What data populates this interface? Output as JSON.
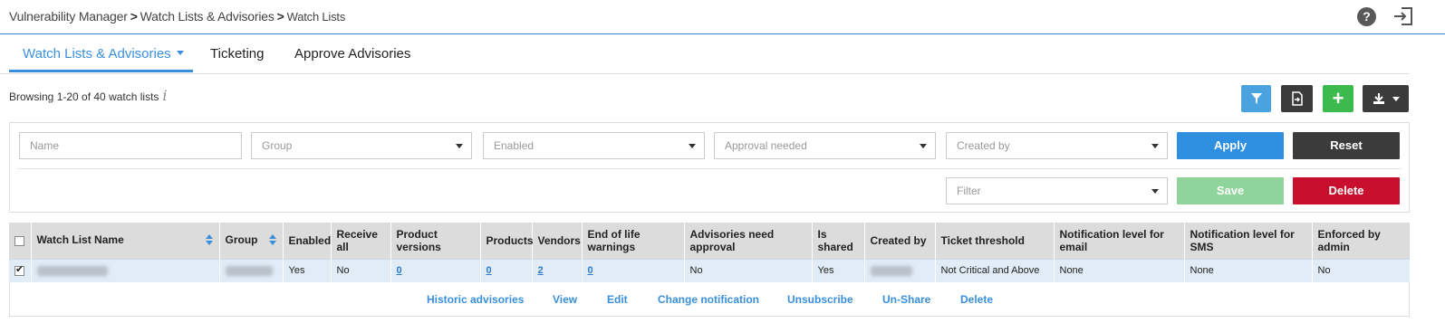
{
  "breadcrumb": {
    "app": "Vulnerability Manager",
    "section": "Watch Lists & Advisories",
    "page": "Watch Lists",
    "separator": ">"
  },
  "header_icons": {
    "help": "help-icon",
    "logout": "logout-icon",
    "help_glyph": "?"
  },
  "tabs": [
    {
      "label": "Watch Lists & Advisories",
      "active": true
    },
    {
      "label": "Ticketing",
      "active": false
    },
    {
      "label": "Approve Advisories",
      "active": false
    }
  ],
  "browsing_text": "Browsing 1-20 of 40 watch lists",
  "info_glyph": "i",
  "filters": {
    "name_placeholder": "Name",
    "group_placeholder": "Group",
    "enabled_placeholder": "Enabled",
    "approval_placeholder": "Approval needed",
    "created_by_placeholder": "Created by",
    "saved_filter_placeholder": "Filter",
    "apply_label": "Apply",
    "reset_label": "Reset",
    "save_label": "Save",
    "delete_label": "Delete"
  },
  "colors": {
    "accent": "#3a8fdd",
    "apply": "#2e8ee0",
    "reset": "#3b3b3b",
    "save": "#8fd49a",
    "delete": "#c8102e",
    "add": "#3dba4e"
  },
  "table": {
    "headers": [
      "Watch List Name",
      "Group",
      "Enabled",
      "Receive all",
      "Product versions",
      "Products",
      "Vendors",
      "End of life warnings",
      "Advisories need approval",
      "Is shared",
      "Created by",
      "Ticket threshold",
      "Notification level for email",
      "Notification level for SMS",
      "Enforced by admin"
    ],
    "row": {
      "enabled": "Yes",
      "receive_all": "No",
      "product_versions": "0",
      "products": "0",
      "vendors": "2",
      "end_of_life": "0",
      "need_approval": "No",
      "is_shared": "Yes",
      "ticket_threshold": "Not Critical and Above",
      "notify_email": "None",
      "notify_sms": "None",
      "enforced": "No"
    }
  },
  "row_actions": [
    "Historic advisories",
    "View",
    "Edit",
    "Change notification",
    "Unsubscribe",
    "Un-Share",
    "Delete"
  ]
}
